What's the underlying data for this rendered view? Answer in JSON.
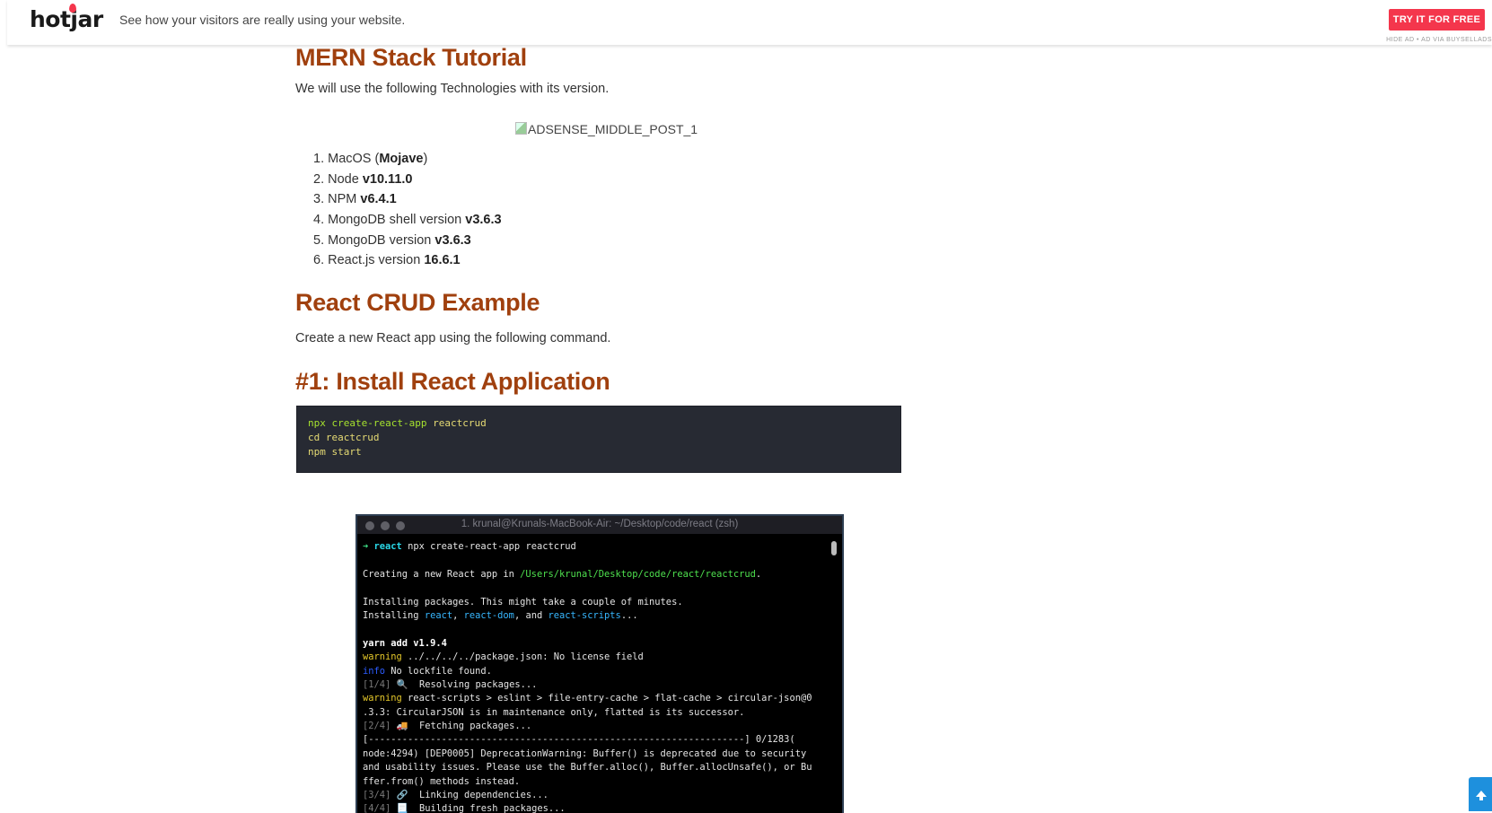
{
  "ad": {
    "logo": "hotjar",
    "tagline": "See how your visitors are really using your website.",
    "cta": "TRY IT FOR FREE",
    "hide_text": "HIDE AD • AD VIA BUYSELLADS",
    "brand_color": "#f4364c"
  },
  "article": {
    "heading_mern": "MERN Stack Tutorial",
    "intro": "We will use the following Technologies with its version.",
    "adsense_alt": "ADSENSE_MIDDLE_POST_1",
    "techs": [
      {
        "num": "1.",
        "label": "MacOS (",
        "value": "Mojave",
        "suffix": ")"
      },
      {
        "num": "2.",
        "label": "Node ",
        "value": "v10.11.0",
        "suffix": ""
      },
      {
        "num": "3.",
        "label": "NPM ",
        "value": "v6.4.1",
        "suffix": ""
      },
      {
        "num": "4.",
        "label": "MongoDB shell version ",
        "value": "v3.6.3",
        "suffix": ""
      },
      {
        "num": "5.",
        "label": "MongoDB version ",
        "value": "v3.6.3",
        "suffix": ""
      },
      {
        "num": "6.",
        "label": "React.js version ",
        "value": "16.6.1",
        "suffix": ""
      }
    ],
    "heading_crud": "React CRUD Example",
    "crud_text": "Create a new React app using the following command.",
    "heading_install": "#1: Install React Application",
    "heading_color": "#a0400e"
  },
  "code": {
    "line1_cmd": "npx",
    "line1_rest": "create-react-app",
    "line1_arg": "reactcrud",
    "line2_cmd": "cd",
    "line2_arg": "reactcrud",
    "line3_cmd": "npm",
    "line3_arg": "start"
  },
  "terminal": {
    "title": "1. krunal@Krunals-MacBook-Air: ~/Desktop/code/react (zsh)",
    "prompt_arrow": "➜",
    "prompt_dir": "react",
    "prompt_cmd": " npx create-react-app reactcrud",
    "creating_prefix": "Creating a new React app in ",
    "creating_path": "/Users/krunal/Desktop/code/react/reactcrud",
    "creating_suffix": ".",
    "installing_line": "Installing packages. This might take a couple of minutes.",
    "installing2_prefix": "Installing ",
    "pkg_react": "react",
    "sep1": ", ",
    "pkg_react_dom": "react-dom",
    "sep2": ", and ",
    "pkg_scripts": "react-scripts",
    "installing2_suffix": "...",
    "yarn_line": "yarn add v1.9.4",
    "warning_label": "warning",
    "warning1_text": " ../../../../package.json: No license field",
    "info_label": "info",
    "info_text": " No lockfile found.",
    "step1": "[1/4]",
    "step1_text": " 🔍  Resolving packages...",
    "warning2_text": " react-scripts > eslint > file-entry-cache > flat-cache > circular-json@0",
    "warning2_cont": ".3.3: CircularJSON is in maintenance only, flatted is its successor.",
    "step2": "[2/4]",
    "step2_text": " 🚚  Fetching packages...",
    "progress": "[-------------------------------------------------------------------] 0/1283(",
    "deprec1": "node:4294) [DEP0005] DeprecationWarning: Buffer() is deprecated due to security",
    "deprec2": "and usability issues. Please use the Buffer.alloc(), Buffer.allocUnsafe(), or Bu",
    "deprec3": "ffer.from() methods instead.",
    "step3": "[3/4]",
    "step3_text": " 🔗  Linking dependencies...",
    "step4": "[4/4]",
    "step4_text": " 📃  Building fresh packages..."
  },
  "scroll_top_icon": "arrow-up-icon"
}
